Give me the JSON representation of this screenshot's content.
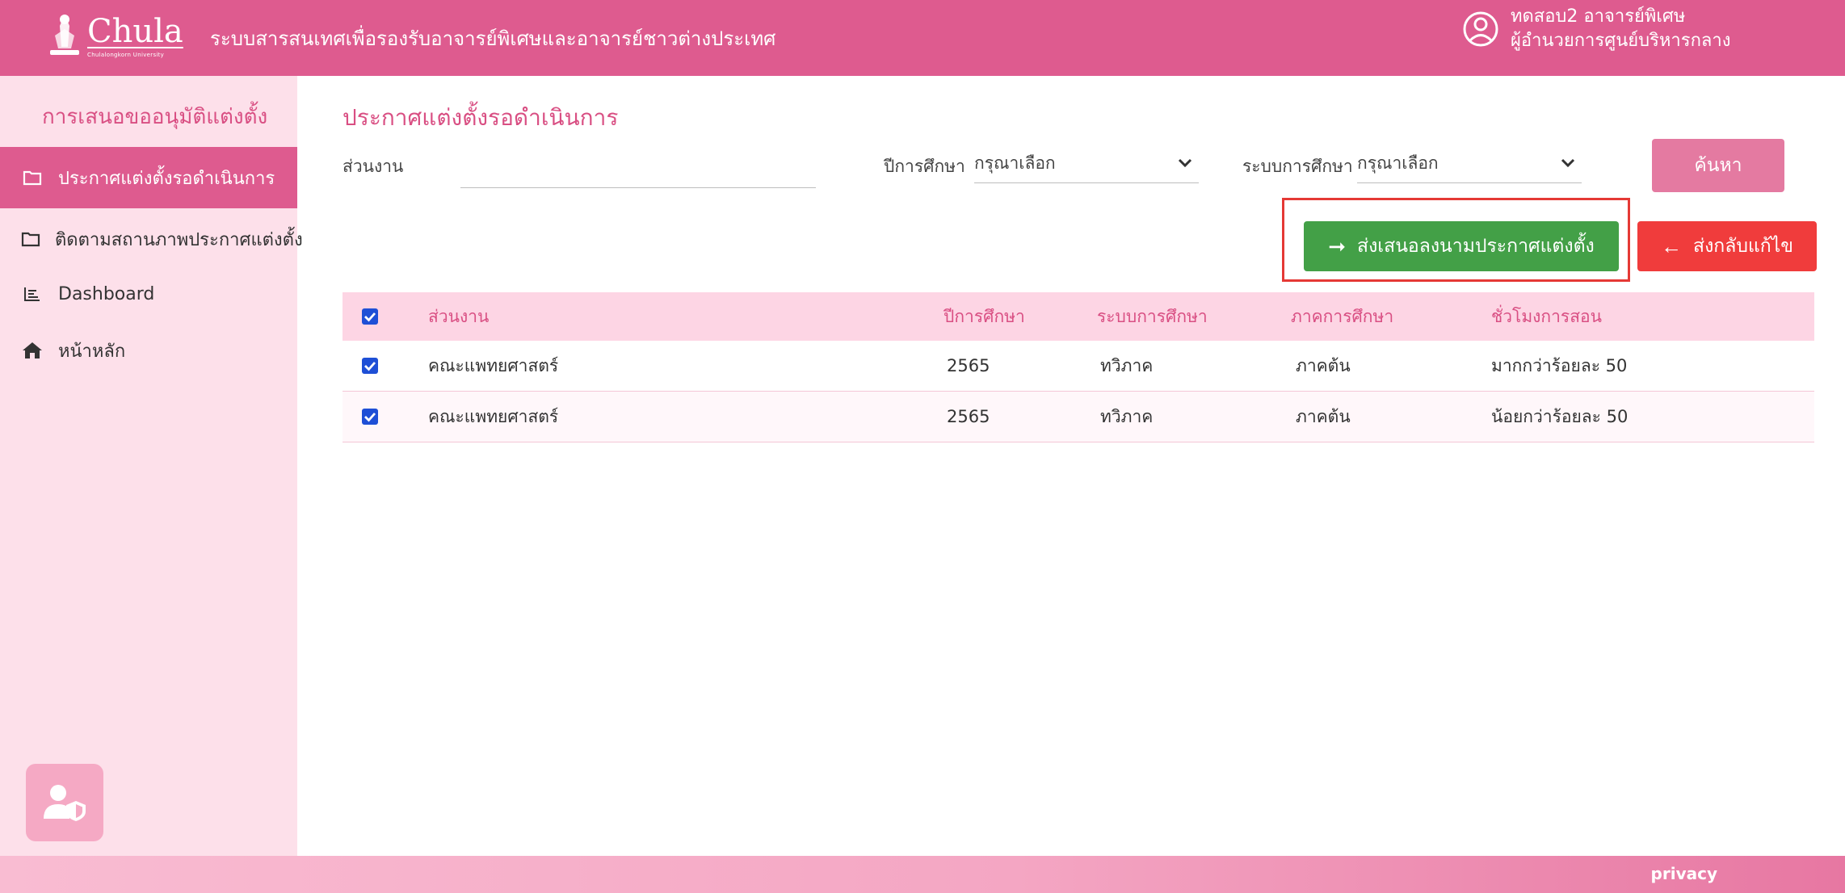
{
  "header": {
    "brand_name": "Chula",
    "brand_sub": "Chulalongkorn University",
    "system_title": "ระบบสารสนเทศเพื่อรองรับอาจารย์พิเศษและอาจารย์ชาวต่างประเทศ",
    "user_name": "ทดสอบ2 อาจารย์พิเศษ",
    "user_role": "ผู้อำนวยการศูนย์บริหารกลาง"
  },
  "sidebar": {
    "heading": "การเสนอขออนุมัติแต่งตั้ง",
    "items": [
      {
        "label": "ประกาศแต่งตั้งรอดำเนินการ",
        "icon": "folder-icon",
        "active": true
      },
      {
        "label": "ติดตามสถานภาพประกาศแต่งตั้ง",
        "icon": "folder-icon",
        "active": false
      },
      {
        "label": "Dashboard",
        "icon": "list-icon",
        "active": false
      },
      {
        "label": "หน้าหลัก",
        "icon": "home-icon",
        "active": false
      }
    ],
    "bottom_icon": "user-shield-icon"
  },
  "main": {
    "title": "ประกาศแต่งตั้งรอดำเนินการ",
    "filters": {
      "dept_label": "ส่วนงาน",
      "dept_value": "",
      "year_label": "ปีการศึกษา",
      "year_value": "กรุณาเลือก",
      "system_label": "ระบบการศึกษา",
      "system_value": "กรุณาเลือก"
    },
    "search_button": "ค้นหา",
    "submit_button": "ส่งเสนอลงนามประกาศแต่งตั้ง",
    "return_button": "ส่งกลับแก้ไข"
  },
  "table": {
    "headers": [
      "ส่วนงาน",
      "ปีการศึกษา",
      "ระบบการศึกษา",
      "ภาคการศึกษา",
      "ชั่วโมงการสอน"
    ],
    "rows": [
      {
        "checked": true,
        "dept": "คณะแพทยศาสตร์",
        "year": "2565",
        "system": "ทวิภาค",
        "semester": "ภาคต้น",
        "hours": "มากกว่าร้อยละ 50"
      },
      {
        "checked": true,
        "dept": "คณะแพทยศาสตร์",
        "year": "2565",
        "system": "ทวิภาค",
        "semester": "ภาคต้น",
        "hours": "น้อยกว่าร้อยละ 50"
      }
    ]
  },
  "footer": {
    "privacy": "privacy"
  },
  "colors": {
    "primary_pink": "#de5b8f",
    "sidebar_bg": "#fde0ea",
    "green": "#43a047",
    "red": "#f03c3c",
    "checkbox_blue": "#1e4fd6"
  }
}
